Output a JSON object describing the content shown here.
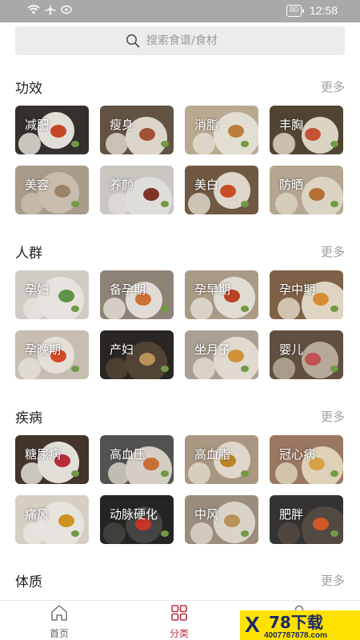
{
  "status": {
    "time": "12:58",
    "battery": "80"
  },
  "search": {
    "placeholder": "搜索食谱/食材"
  },
  "sections": [
    {
      "title": "功效",
      "more": "更多",
      "items": [
        {
          "label": "减肥",
          "bg": "#3a3530",
          "plate": "#f4f1ea",
          "accent": "#d94a2b"
        },
        {
          "label": "瘦身",
          "bg": "#6b5a4a",
          "plate": "#efe8dc",
          "accent": "#b05a3a"
        },
        {
          "label": "消脂",
          "bg": "#c9b89e",
          "plate": "#f7f1e4",
          "accent": "#c98a3e"
        },
        {
          "label": "丰胸",
          "bg": "#5a4a38",
          "plate": "#eee6d6",
          "accent": "#d65a3a"
        },
        {
          "label": "美容",
          "bg": "#b8a996",
          "plate": "#d8cdbd",
          "accent": "#a88f72"
        },
        {
          "label": "养颜",
          "bg": "#dcd8d2",
          "plate": "#f2f0ec",
          "accent": "#8a3a2a"
        },
        {
          "label": "美白",
          "bg": "#7a6048",
          "plate": "#f1e9dc",
          "accent": "#d8542a"
        },
        {
          "label": "防晒",
          "bg": "#c4b59e",
          "plate": "#efe6d4",
          "accent": "#c67a3a"
        }
      ]
    },
    {
      "title": "人群",
      "more": "更多",
      "items": [
        {
          "label": "孕妇",
          "bg": "#e2ddd5",
          "plate": "#faf7f1",
          "accent": "#6aa04a"
        },
        {
          "label": "备孕期",
          "bg": "#9a8e80",
          "plate": "#f3eee6",
          "accent": "#e07a3a"
        },
        {
          "label": "孕早期",
          "bg": "#b8a892",
          "plate": "#f5efe3",
          "accent": "#c94a2a"
        },
        {
          "label": "孕中期",
          "bg": "#8a6a4e",
          "plate": "#f2e6d2",
          "accent": "#e89a3a"
        },
        {
          "label": "孕晚期",
          "bg": "#d8cfc2",
          "plate": "#f8f3ea",
          "accent": "#e8502a"
        },
        {
          "label": "产妇",
          "bg": "#2e2a26",
          "plate": "#5a4a3a",
          "accent": "#c8a060"
        },
        {
          "label": "坐月子",
          "bg": "#b8aea0",
          "plate": "#f3ede2",
          "accent": "#e0a040"
        },
        {
          "label": "婴儿",
          "bg": "#6a5648",
          "plate": "#c7b8a6",
          "accent": "#d05a5a"
        }
      ]
    },
    {
      "title": "疾病",
      "more": "更多",
      "items": [
        {
          "label": "糖尿病",
          "bg": "#4a3a30",
          "plate": "#f6f2ec",
          "accent": "#c8303a"
        },
        {
          "label": "高血压",
          "bg": "#5a5a58",
          "plate": "#e6e0d6",
          "accent": "#d8783a"
        },
        {
          "label": "高血脂",
          "bg": "#b8a48c",
          "plate": "#f2eadc",
          "accent": "#c9902a"
        },
        {
          "label": "冠心病",
          "bg": "#a8826a",
          "plate": "#f1e3c8",
          "accent": "#e8b04a"
        },
        {
          "label": "痛风",
          "bg": "#e8e0d4",
          "plate": "#fbf8f2",
          "accent": "#e0a020"
        },
        {
          "label": "动脉硬化",
          "bg": "#2a2826",
          "plate": "#4a4a48",
          "accent": "#d83a2a"
        },
        {
          "label": "中风",
          "bg": "#a89a88",
          "plate": "#ede6da",
          "accent": "#c8a060"
        },
        {
          "label": "肥胖",
          "bg": "#3a3836",
          "plate": "#5a5048",
          "accent": "#e0602a"
        }
      ]
    },
    {
      "title": "体质",
      "more": "更多",
      "items": []
    }
  ],
  "tabs": [
    {
      "label": "首页",
      "icon": "home-icon"
    },
    {
      "label": "分类",
      "icon": "grid-icon"
    },
    {
      "label": "",
      "icon": "user-icon"
    }
  ],
  "watermark": {
    "mark": "X",
    "brand": "78下载",
    "url": "4007787878.com"
  },
  "colors": {
    "accent": "#c0303f",
    "status_bar": "#a9a9a9",
    "search_bg": "#ececec"
  }
}
